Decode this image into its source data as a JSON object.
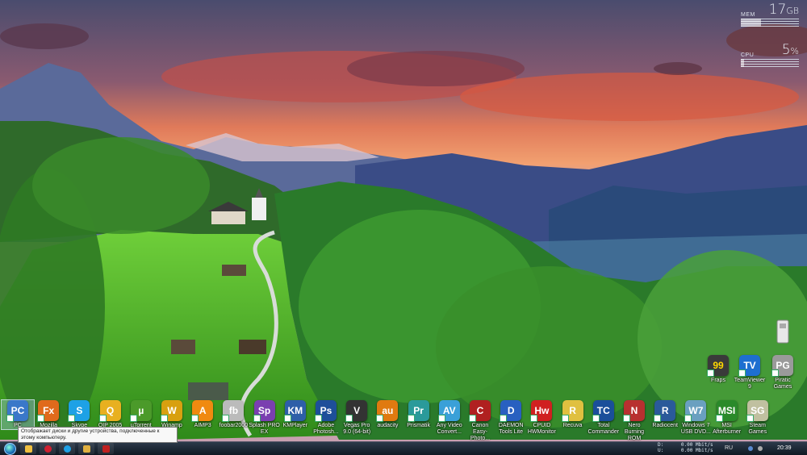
{
  "meters": {
    "mem": {
      "label": "MEM",
      "value": "17",
      "unit": "GB"
    },
    "cpu": {
      "label": "CPU",
      "value": "5",
      "unit": "%"
    }
  },
  "tooltip": "Отображает диски и другие устройства, подключенные к этому компьютеру.",
  "side_icons": [
    {
      "name": "Fraps",
      "color": "#3a3a3a",
      "glyph": "99"
    },
    {
      "name": "TeamViewer 9",
      "color": "#1e6fd0",
      "glyph": "TV"
    },
    {
      "name": "Piratic Games",
      "color": "#9a9a9a",
      "glyph": "PG"
    }
  ],
  "bottom_icons": [
    {
      "name": "PC",
      "color": "#3a78c9",
      "glyph": "PC"
    },
    {
      "name": "Mozilla",
      "color": "#e06a1c",
      "glyph": "Fx"
    },
    {
      "name": "Skype",
      "color": "#1ea1e6",
      "glyph": "S"
    },
    {
      "name": "QIP 2005",
      "color": "#e8b020",
      "glyph": "Q"
    },
    {
      "name": "µTorrent",
      "color": "#4b9a2a",
      "glyph": "µ"
    },
    {
      "name": "Winamp",
      "color": "#d8a010",
      "glyph": "W"
    },
    {
      "name": "AIMP3",
      "color": "#f08a10",
      "glyph": "A"
    },
    {
      "name": "foobar2000",
      "color": "#bbbbbb",
      "glyph": "fb"
    },
    {
      "name": "Splash PRO EX",
      "color": "#7a3fb0",
      "glyph": "Sp"
    },
    {
      "name": "KMPlayer",
      "color": "#2e5fa8",
      "glyph": "KM"
    },
    {
      "name": "Adobe Photosh...",
      "color": "#1e4f9a",
      "glyph": "Ps"
    },
    {
      "name": "Vegas Pro 9.0 (64-bit)",
      "color": "#333333",
      "glyph": "V"
    },
    {
      "name": "audacity",
      "color": "#e07a10",
      "glyph": "au"
    },
    {
      "name": "Prismatik",
      "color": "#2a9a9a",
      "glyph": "Pr"
    },
    {
      "name": "Any Video Convert...",
      "color": "#3aa0d8",
      "glyph": "AV"
    },
    {
      "name": "Canon Easy-Photo...",
      "color": "#b02020",
      "glyph": "C"
    },
    {
      "name": "DAEMON Tools Lite",
      "color": "#2860c0",
      "glyph": "D"
    },
    {
      "name": "CPUID HWMonitor",
      "color": "#d02020",
      "glyph": "Hw"
    },
    {
      "name": "Recuva",
      "color": "#e0c040",
      "glyph": "R"
    },
    {
      "name": "Total Commander",
      "color": "#1a4f9a",
      "glyph": "TC"
    },
    {
      "name": "Nero Burning ROM",
      "color": "#b83030",
      "glyph": "N"
    },
    {
      "name": "Radiocent",
      "color": "#2a5a9a",
      "glyph": "R"
    },
    {
      "name": "Windows 7 USB DVD...",
      "color": "#6aa0c0",
      "glyph": "W7"
    },
    {
      "name": "MSI Afterburner",
      "color": "#2a8a2a",
      "glyph": "MSI"
    },
    {
      "name": "Steam Games",
      "color": "#c0c0a0",
      "glyph": "SG"
    }
  ],
  "taskbar": {
    "buttons": [
      {
        "name": "explorer",
        "color": "#f0c040"
      },
      {
        "name": "opera",
        "color": "#d02030"
      },
      {
        "name": "skype",
        "color": "#1ea1e6"
      },
      {
        "name": "folder",
        "color": "#e0b040"
      },
      {
        "name": "app",
        "color": "#c02020"
      }
    ],
    "net": "D:      0.00 Mbit/s\nU:      0.00 Mbit/s",
    "lang": "RU",
    "clock": "20:39"
  }
}
